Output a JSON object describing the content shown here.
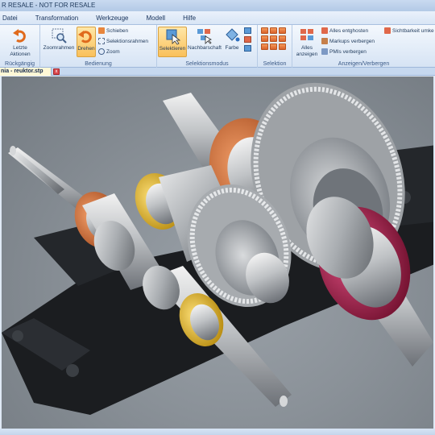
{
  "window": {
    "title": "R RESALE - NOT FOR RESALE"
  },
  "menu": [
    "Datei",
    "Transformation",
    "Werkzeuge",
    "Modell",
    "Hilfe"
  ],
  "ribbon": {
    "undo": {
      "label_line1": "Letzte",
      "label_line2": "Aktionen",
      "group": "Rückgängig"
    },
    "navigation": {
      "zoom_frame": "Zoomrahmen",
      "rotate": "Drehen",
      "pan": "Schieben",
      "selection_frame": "Selektionsrahmen",
      "zoom": "Zoom",
      "group": "Bedienung"
    },
    "selection_mode": {
      "select": "Selektieren",
      "neighborhood": "Nachbarschaft",
      "color": "Farbe",
      "group": "Selektionsmodus"
    },
    "selection": {
      "group": "Selektion"
    },
    "show_hide": {
      "show_all_line1": "Alles",
      "show_all_line2": "anzeigen",
      "unghost_all": "Alles entghosten",
      "hide_markups": "Markups verbergen",
      "hide_pmis": "PMIs verbergen",
      "visibility": "Sichtbarkeit umke",
      "group": "Anzeigen/Verbergen"
    }
  },
  "document": {
    "tab_label": "nia - reuktor.stp",
    "close_glyph": "x"
  },
  "colors": {
    "gear_orange": "#c8632e",
    "ring_yellow": "#e3b31c",
    "hub_magenta": "#a41d48",
    "housing": "#1b1d20"
  }
}
